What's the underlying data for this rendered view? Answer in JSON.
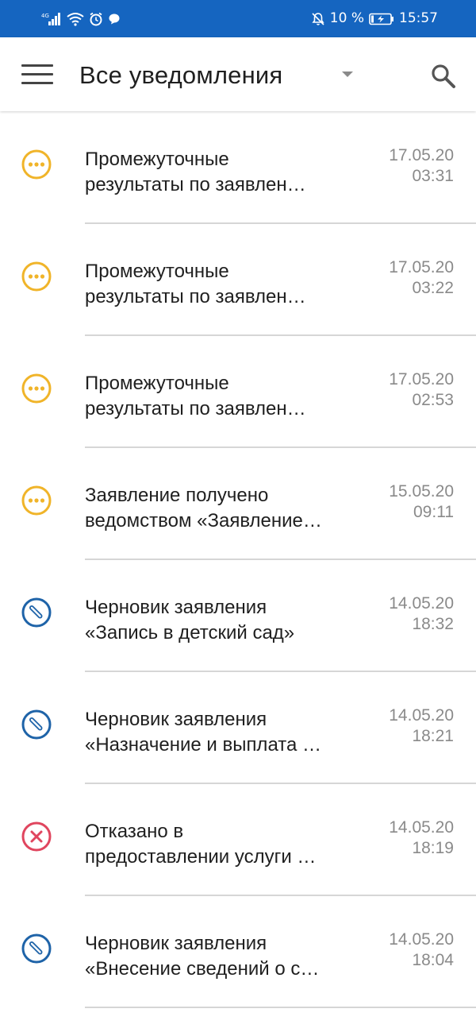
{
  "status_bar": {
    "network": "4G",
    "battery_percent": "10 %",
    "time": "15:57"
  },
  "app_bar": {
    "title": "Все уведомления",
    "menu_icon": "hamburger-menu-icon",
    "dropdown_icon": "dropdown-arrow-icon",
    "search_icon": "search-icon"
  },
  "colors": {
    "status_bar_bg": "#1565c0",
    "pending": "#f0b429",
    "draft": "#1e63a8",
    "rejected": "#e0455e"
  },
  "notifications": [
    {
      "type": "pending",
      "icon": "ellipsis-circle-icon",
      "line1": "Промежуточные",
      "line2": "результаты по заявлен…",
      "date": "17.05.20",
      "time": "03:31"
    },
    {
      "type": "pending",
      "icon": "ellipsis-circle-icon",
      "line1": "Промежуточные",
      "line2": "результаты по заявлен…",
      "date": "17.05.20",
      "time": "03:22"
    },
    {
      "type": "pending",
      "icon": "ellipsis-circle-icon",
      "line1": "Промежуточные",
      "line2": "результаты по заявлен…",
      "date": "17.05.20",
      "time": "02:53"
    },
    {
      "type": "pending",
      "icon": "ellipsis-circle-icon",
      "line1": "Заявление получено",
      "line2": "ведомством «Заявление…",
      "date": "15.05.20",
      "time": "09:11"
    },
    {
      "type": "draft",
      "icon": "pencil-circle-icon",
      "line1": "Черновик заявления",
      "line2": "«Запись в детский сад»",
      "date": "14.05.20",
      "time": "18:32"
    },
    {
      "type": "draft",
      "icon": "pencil-circle-icon",
      "line1": "Черновик заявления",
      "line2": "«Назначение и выплата …",
      "date": "14.05.20",
      "time": "18:21"
    },
    {
      "type": "rejected",
      "icon": "cross-circle-icon",
      "line1": "Отказано в",
      "line2": "предоставлении услуги …",
      "date": "14.05.20",
      "time": "18:19"
    },
    {
      "type": "draft",
      "icon": "pencil-circle-icon",
      "line1": "Черновик заявления",
      "line2": "«Внесение сведений о с…",
      "date": "14.05.20",
      "time": "18:04"
    }
  ]
}
